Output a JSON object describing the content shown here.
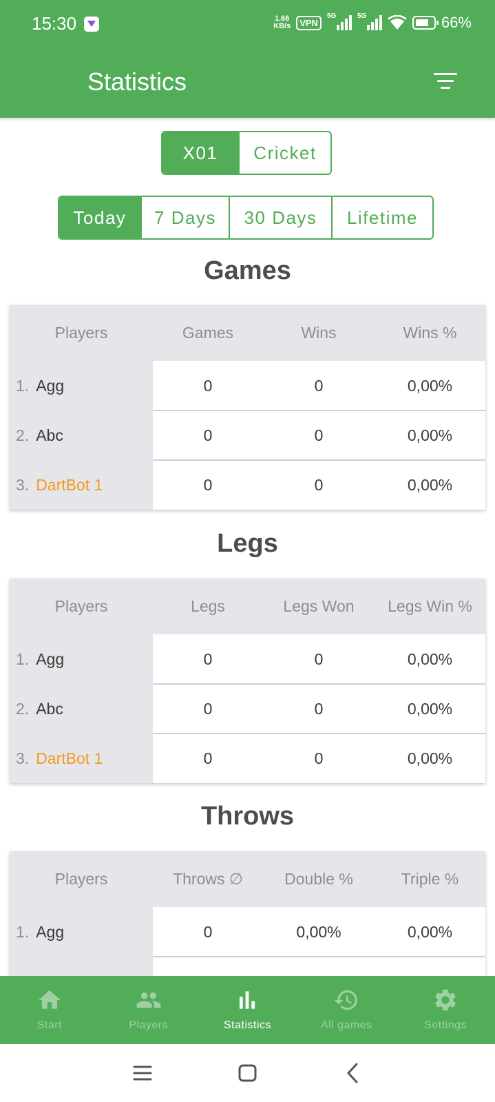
{
  "status_bar": {
    "time": "15:30",
    "net_speed_value": "1.66",
    "net_speed_unit": "KB/s",
    "vpn": "VPN",
    "signal_tag_1": "5G",
    "signal_tag_2": "5G",
    "battery": "66%"
  },
  "header": {
    "title": "Statistics"
  },
  "game_type_tabs": [
    {
      "label": "X01",
      "active": true
    },
    {
      "label": "Cricket",
      "active": false
    }
  ],
  "period_tabs": [
    {
      "label": "Today",
      "active": true
    },
    {
      "label": "7 Days",
      "active": false
    },
    {
      "label": "30 Days",
      "active": false
    },
    {
      "label": "Lifetime",
      "active": false
    }
  ],
  "sections": {
    "games": {
      "title": "Games",
      "headers": [
        "Players",
        "Games",
        "Wins",
        "Wins %"
      ],
      "rows": [
        {
          "rank": "1.",
          "player": "Agg",
          "v1": "0",
          "v2": "0",
          "v3": "0,00%"
        },
        {
          "rank": "2.",
          "player": "Abc",
          "v1": "0",
          "v2": "0",
          "v3": "0,00%"
        },
        {
          "rank": "3.",
          "player": "DartBot 1",
          "v1": "0",
          "v2": "0",
          "v3": "0,00%"
        }
      ]
    },
    "legs": {
      "title": "Legs",
      "headers": [
        "Players",
        "Legs",
        "Legs Won",
        "Legs Win %"
      ],
      "rows": [
        {
          "rank": "1.",
          "player": "Agg",
          "v1": "0",
          "v2": "0",
          "v3": "0,00%"
        },
        {
          "rank": "2.",
          "player": "Abc",
          "v1": "0",
          "v2": "0",
          "v3": "0,00%"
        },
        {
          "rank": "3.",
          "player": "DartBot 1",
          "v1": "0",
          "v2": "0",
          "v3": "0,00%"
        }
      ]
    },
    "throws": {
      "title": "Throws",
      "headers": [
        "Players",
        "Throws ∅",
        "Double %",
        "Triple %"
      ],
      "rows": [
        {
          "rank": "1.",
          "player": "Agg",
          "v1": "0",
          "v2": "0,00%",
          "v3": "0,00%"
        }
      ]
    }
  },
  "bottom_nav": [
    {
      "label": "Start",
      "icon": "home-icon",
      "active": false
    },
    {
      "label": "Players",
      "icon": "players-icon",
      "active": false
    },
    {
      "label": "Statistics",
      "icon": "bar-chart-icon",
      "active": true
    },
    {
      "label": "All games",
      "icon": "history-icon",
      "active": false
    },
    {
      "label": "Settings",
      "icon": "gear-icon",
      "active": false
    }
  ],
  "colors": {
    "primary": "#52ad59",
    "bot_player": "#f39a1f",
    "table_bg": "#e6e6ea"
  }
}
